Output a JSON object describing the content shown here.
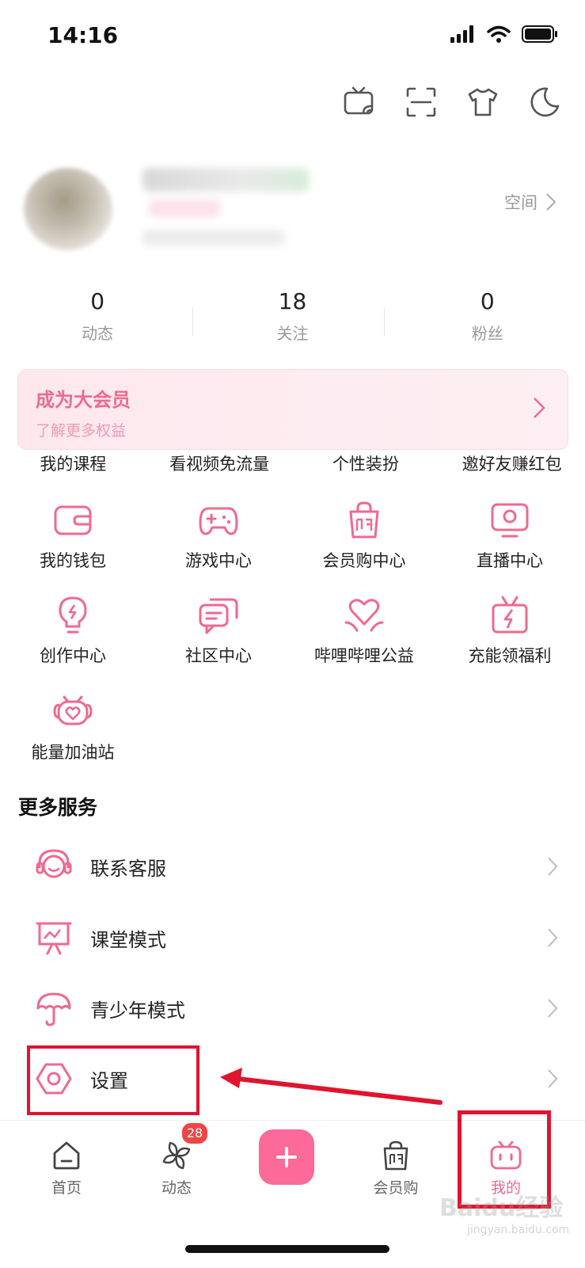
{
  "status_bar": {
    "time": "14:16"
  },
  "top_icons": [
    "tv-cast-icon",
    "scan-icon",
    "tshirt-icon",
    "moon-icon"
  ],
  "profile": {
    "space_label": "空间"
  },
  "stats": [
    {
      "value": "0",
      "label": "动态"
    },
    {
      "value": "18",
      "label": "关注"
    },
    {
      "value": "0",
      "label": "粉丝"
    }
  ],
  "vip": {
    "title": "成为大会员",
    "subtitle": "了解更多权益"
  },
  "services_top": [
    "我的课程",
    "看视频免流量",
    "个性装扮",
    "邀好友赚红包"
  ],
  "services_grid": [
    {
      "label": "我的钱包",
      "icon": "wallet-icon"
    },
    {
      "label": "游戏中心",
      "icon": "gamepad-icon"
    },
    {
      "label": "会员购中心",
      "icon": "shopping-bag-icon"
    },
    {
      "label": "直播中心",
      "icon": "monitor-icon"
    },
    {
      "label": "创作中心",
      "icon": "lightbulb-icon"
    },
    {
      "label": "社区中心",
      "icon": "chat-icon"
    },
    {
      "label": "哔哩哔哩公益",
      "icon": "heart-hands-icon"
    },
    {
      "label": "充能领福利",
      "icon": "gift-bolt-icon"
    },
    {
      "label": "能量加油站",
      "icon": "heart-basket-icon"
    }
  ],
  "more_services": {
    "title": "更多服务",
    "items": [
      {
        "label": "联系客服",
        "icon": "headset-icon"
      },
      {
        "label": "课堂模式",
        "icon": "presentation-icon"
      },
      {
        "label": "青少年模式",
        "icon": "umbrella-icon"
      },
      {
        "label": "设置",
        "icon": "settings-hexagon-icon"
      }
    ]
  },
  "bottom_nav": {
    "items": [
      {
        "label": "首页",
        "icon": "home-icon"
      },
      {
        "label": "动态",
        "icon": "pinwheel-icon",
        "badge": "28"
      },
      {
        "label": "",
        "icon": "plus-icon"
      },
      {
        "label": "会员购",
        "icon": "shopping-bag-icon"
      },
      {
        "label": "我的",
        "icon": "tv-face-icon",
        "active": true
      }
    ]
  },
  "watermark": {
    "text": "Baidu经验",
    "sub": "jingyan.baidu.com"
  },
  "colors": {
    "accent": "#f0698f",
    "annotation": "#e0142e"
  }
}
